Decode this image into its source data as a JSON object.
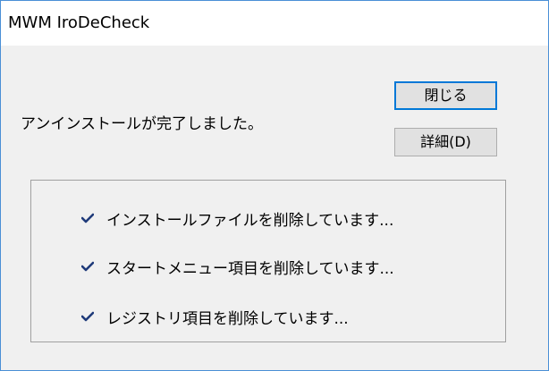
{
  "window": {
    "title": "MWM IroDeCheck"
  },
  "message": "アンインストールが完了しました。",
  "buttons": {
    "close_label": "閉じる",
    "details_label": "詳細(D)"
  },
  "steps": [
    {
      "label": "インストールファイルを削除しています...",
      "icon": "check-icon",
      "status": "done"
    },
    {
      "label": "スタートメニュー項目を削除しています...",
      "icon": "check-icon",
      "status": "done"
    },
    {
      "label": "レジストリ項目を削除しています...",
      "icon": "check-icon",
      "status": "done"
    }
  ],
  "colors": {
    "check": "#1f3a7a",
    "window_border": "#4a8fd6",
    "default_button_border": "#0078d7",
    "dialog_background": "#f0f0f0"
  }
}
